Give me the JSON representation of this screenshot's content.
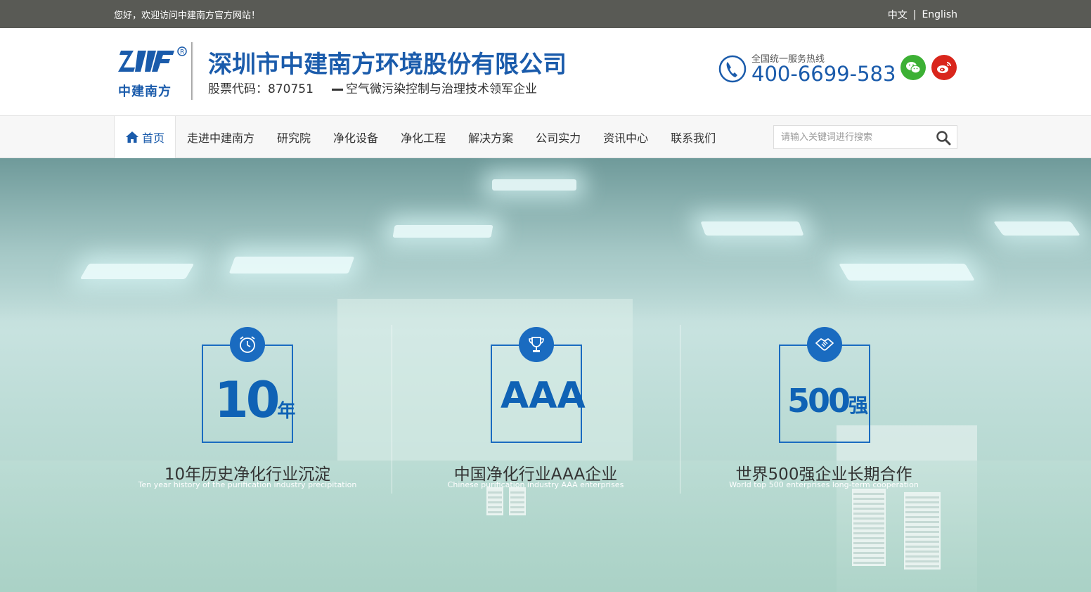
{
  "topbar": {
    "greeting": "您好，欢迎访问中建南方官方网站！",
    "lang_cn": "中文",
    "lang_sep": "|",
    "lang_en": "English"
  },
  "header": {
    "logo_text": "中建南方",
    "company_name": "深圳市中建南方环境股份有限公司",
    "stock_code": "股票代码：870751",
    "slogan": "空气微污染控制与治理技术领军企业",
    "hotline_label": "全国统一服务热线",
    "hotline_number": "400-6699-583"
  },
  "nav": {
    "items": [
      {
        "label": "首页",
        "active": true
      },
      {
        "label": "走进中建南方"
      },
      {
        "label": "研究院"
      },
      {
        "label": "净化设备"
      },
      {
        "label": "净化工程"
      },
      {
        "label": "解决方案"
      },
      {
        "label": "公司实力"
      },
      {
        "label": "资讯中心"
      },
      {
        "label": "联系我们"
      }
    ],
    "search_placeholder": "请输入关键词进行搜索"
  },
  "stats": [
    {
      "value": "10",
      "unit": "年",
      "title": "10年历史净化行业沉淀",
      "subtitle": "Ten year history of the purification industry precipitation",
      "icon": "clock-icon"
    },
    {
      "value": "AAA",
      "unit": "",
      "title": "中国净化行业AAA企业",
      "subtitle": "Chinese purification industry AAA enterprises",
      "icon": "trophy-icon"
    },
    {
      "value": "500",
      "unit": "强",
      "title": "世界500强企业长期合作",
      "subtitle": "World top 500 enterprises long-term cooperation",
      "icon": "handshake-icon"
    }
  ],
  "colors": {
    "brand_blue": "#1a5bab",
    "topbar_bg": "#595a55",
    "wechat_green": "#3cb034",
    "weibo_red": "#d9261c"
  }
}
